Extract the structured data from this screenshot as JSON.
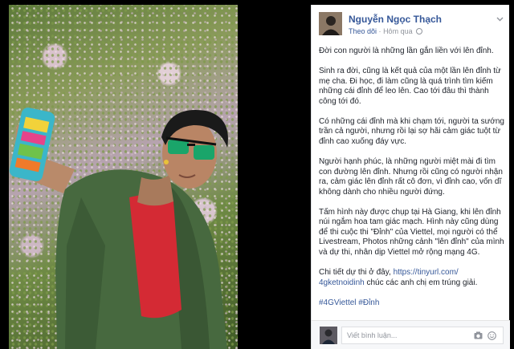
{
  "post": {
    "author": "Nguyễn Ngọc Thạch",
    "follow_label": "Theo dõi",
    "timestamp": "Hôm qua",
    "separator": "·",
    "paragraphs": [
      "Đời con người là những lần gắn liền với lên đỉnh.",
      "Sinh ra đời, cũng là kết quả của một lần lên đỉnh từ mẹ cha. Đi học, đi làm cũng là quá trình tìm kiếm những cái đỉnh để leo lên. Cao tới đâu thì thành công tới đó.",
      "Có những cái đỉnh mà khi chạm tới, người ta sướng trần cả người, nhưng rồi lại sợ hãi cảm giác tuột từ đỉnh cao xuống đáy vực.",
      "Người hạnh phúc, là những người miệt mài đi tìm con đường lên đỉnh. Nhưng rồi cũng có người nhận ra, cảm giác lên đỉnh rất cô đơn, vì đỉnh cao, vốn dĩ không dành cho nhiều người đứng.",
      "Tấm hình này được chụp tại Hà Giang, khi lên đỉnh núi ngắm hoa tam giác mạch. Hình này cũng dùng để thi cuộc thi \"Đỉnh\" của Viettel, mọi người có thể Livestream, Photos những cảnh \"lên đỉnh\" của mình và dự thi, nhân dịp Viettel mở rộng mạng 4G."
    ],
    "details_prefix": "Chi tiết dự thi ở đây,",
    "details_link": "https://tinyurl.com/",
    "hashtag_link": "4gketnoidinh",
    "details_suffix": "chúc các anh chị em trúng giải.",
    "tags": [
      "#4GViettel",
      "#Đỉnh"
    ]
  },
  "comment": {
    "placeholder": "Viết bình luận..."
  },
  "colors": {
    "link": "#365899",
    "text": "#1d2129",
    "muted": "#90949c"
  },
  "icons": [
    "chevron-down-icon",
    "globe-icon",
    "camera-icon",
    "smiley-icon"
  ]
}
